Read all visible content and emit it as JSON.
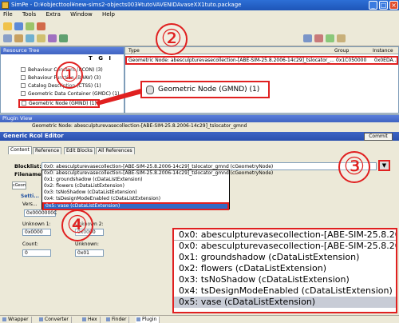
{
  "window": {
    "title": "SimPe - D:¥objecttool¥new-sims2-objects003¥tutoVAVENIDAvaseXX1tuto.package"
  },
  "menu": [
    "File",
    "Tools",
    "Extra",
    "Window",
    "Help"
  ],
  "resource_tree": {
    "header": "Resource Tree",
    "filter_buttons": [
      "T",
      "G",
      "I"
    ],
    "items": [
      "Behaviour Constant (BCON) (3)",
      "Behaviour Function (BHAV) (3)",
      "Catalog Description (CTSS) (1)",
      "Geometric Data Container (GMDC) (1)",
      "Geometric Node (GMND) (1)"
    ]
  },
  "resource_list": {
    "columns": [
      "Type",
      "Group",
      "Instance"
    ],
    "row": {
      "type": "Geometric Node: abesculpturevasecollection-[ABE-SIM-25.8.2006-14c29]_tslocator_...",
      "group": "0x1C050000",
      "instance": "0x0EDA..."
    }
  },
  "callout_gmnd": "Geometric Node (GMND) (1)",
  "plugin_view": {
    "header": "Plugin View",
    "doc_title": "Geometric Node: abesculpturevasecollection-[ABE-SIM-25.8.2006-14c29]_tslocator_gmnd",
    "editor_title": "Generic Rcol Editor",
    "commit_label": "Commit",
    "tabs": [
      "Content",
      "Reference",
      "Edit Blocks",
      "All References"
    ],
    "inner_tab": "cGeom...",
    "blocklist_label": "Blocklist:",
    "blocklist_value": "0x0: abesculpturevasecollection-[ABE-SIM-25.8.2006-14c29]_tslocator_gmnd (cGeometryNode)",
    "filename_label": "Filename:",
    "settings_label": "Setti...",
    "version_label": "Vers...",
    "version_value": "0x0000000C",
    "dropdown_items": [
      "0x0: abesculpturevasecollection-[ABE-SIM-25.8.2006-14c29]_tslocator_gmnd (cGeometryNode)",
      "0x1: groundshadow (cDataListExtension)",
      "0x2: flowers (cDataListExtension)",
      "0x3: tsNoShadow (cDataListExtension)",
      "0x4: tsDesignModeEnabled (cDataListExtension)",
      "0x5: vase (cDataListExtension)"
    ],
    "unknown1_label": "Unknown 1:",
    "unknown1_value": "0x0000",
    "unknown2_label": "Unknown 2:",
    "unknown2_value": "0x0000",
    "count_label": "Count:",
    "count_value": "0",
    "unknown_label": "Unknown:",
    "unknown_value": "0x01"
  },
  "zoom_callout": {
    "items": [
      "0x0: abesculpturevasecollection-[ABE-SIM-25.8.20",
      "0x0: abesculpturevasecollection-[ABE-SIM-25.8.20",
      "0x1: groundshadow (cDataListExtension)",
      "0x2: flowers (cDataListExtension)",
      "0x3: tsNoShadow (cDataListExtension)",
      "0x4: tsDesignModeEnabled (cDataListExtension)",
      "0x5: vase (cDataListExtension)"
    ]
  },
  "markers": [
    "②",
    "①",
    "③",
    "④"
  ],
  "bottom_tabs": [
    "Wrapper",
    "Converter",
    "Hex",
    "Finder",
    "Plugin"
  ],
  "colors": {
    "annotation_red": "#e02020",
    "header_blue": "#3f63c0",
    "selection_blue": "#316ac5"
  }
}
